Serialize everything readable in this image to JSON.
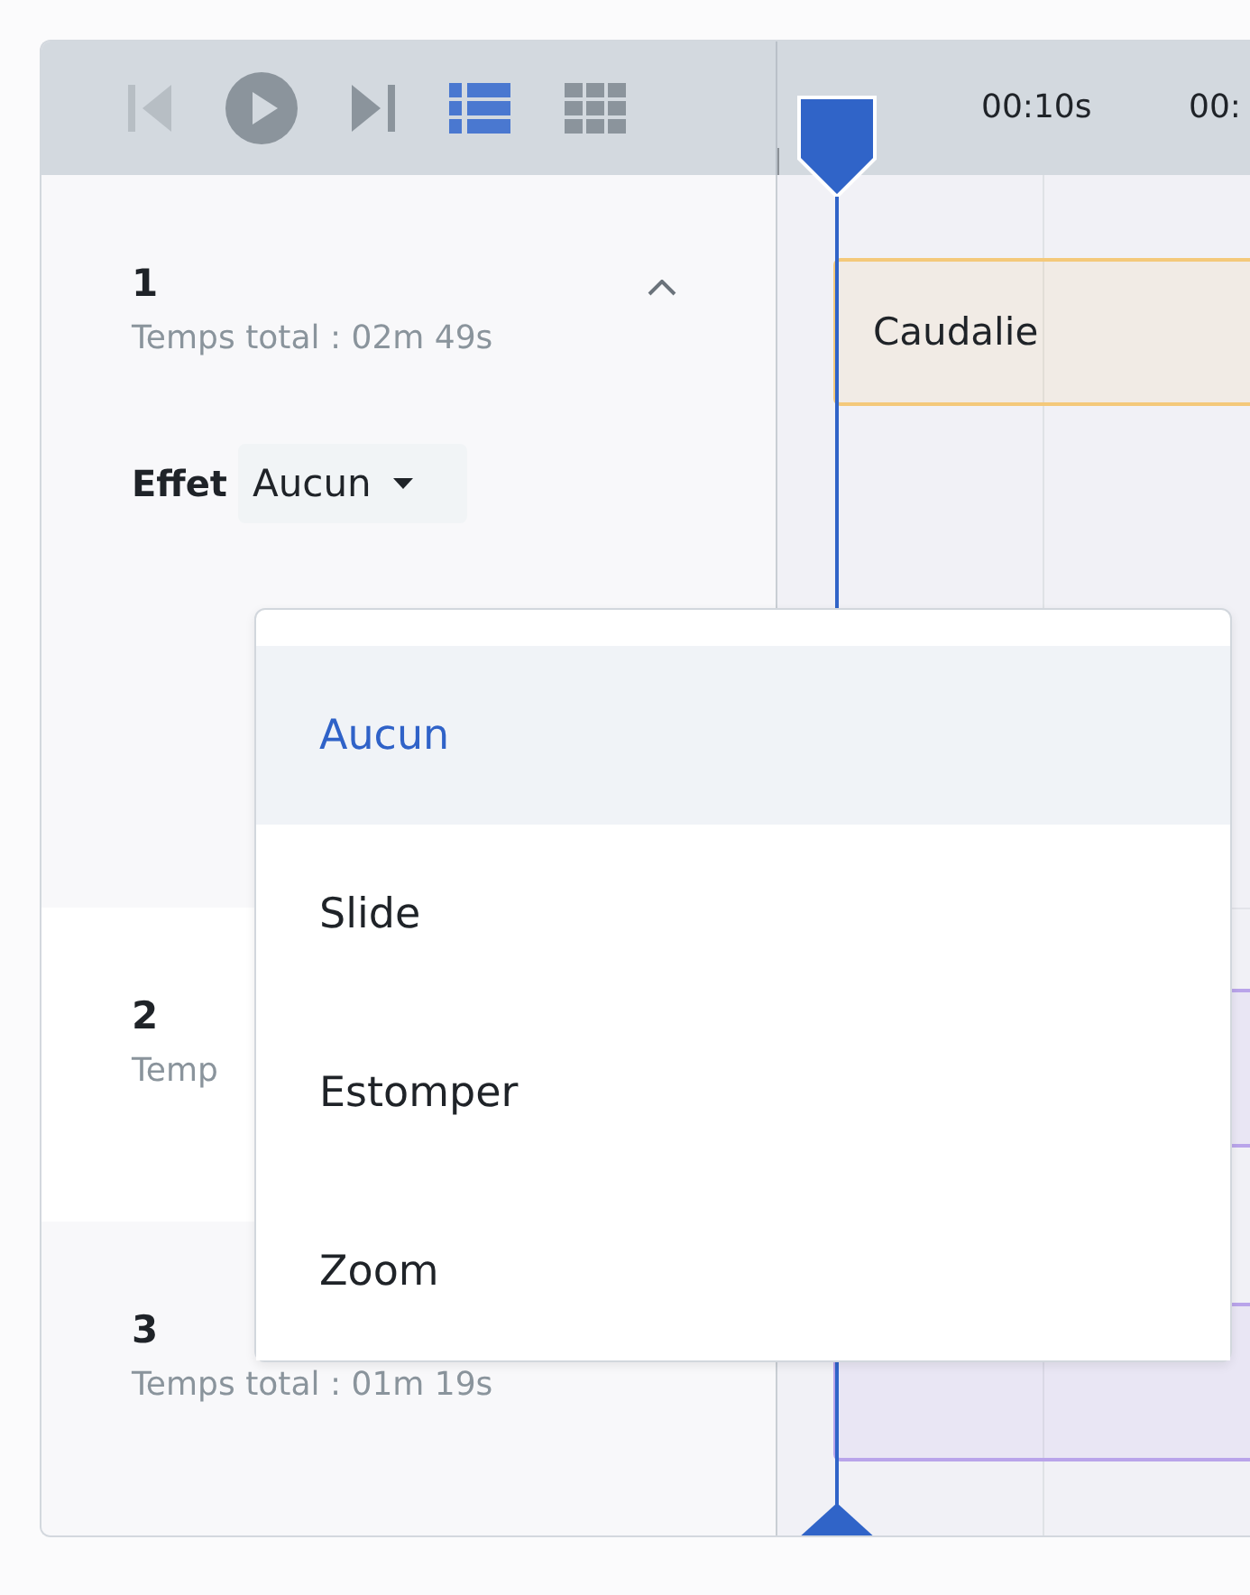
{
  "toolbar": {
    "buttons": [
      {
        "kind": "previous",
        "disabled": true,
        "selected": false
      },
      {
        "kind": "play",
        "disabled": false,
        "selected": false
      },
      {
        "kind": "next",
        "disabled": false,
        "selected": false
      },
      {
        "kind": "list",
        "disabled": false,
        "selected": true
      },
      {
        "kind": "grid",
        "disabled": false,
        "selected": false
      }
    ]
  },
  "ruler": {
    "ticks": [
      "00:10s",
      "00:"
    ]
  },
  "scenes": [
    {
      "number": "1",
      "duration": "Temps total : 02m 49s",
      "expanded": true,
      "effect_label": "Effet",
      "effect_value": "Aucun",
      "clip": "Caudalie",
      "color": "#f4c97a"
    },
    {
      "number": "2",
      "duration": "Temp",
      "color": "#b9a4ea"
    },
    {
      "number": "3",
      "duration": "Temps total : 01m 19s",
      "color": "#b9a4ea"
    }
  ],
  "effect_menu": {
    "options": [
      {
        "label": "Aucun",
        "selected": true
      },
      {
        "label": "Slide",
        "selected": false
      },
      {
        "label": "Estomper",
        "selected": false
      },
      {
        "label": "Zoom",
        "selected": false
      }
    ]
  }
}
